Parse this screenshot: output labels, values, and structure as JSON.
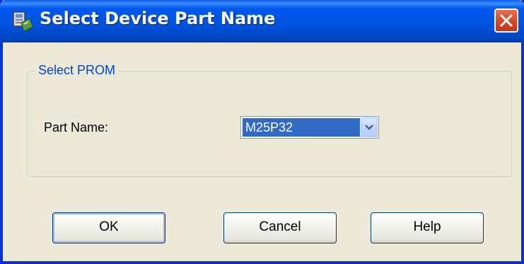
{
  "window": {
    "title": "Select Device Part Name",
    "colors": {
      "titlebar": "#0058EE",
      "frame": "#0831D9",
      "dialog_bg": "#ECE9D8",
      "group_label": "#0046D5",
      "selection": "#316AC5",
      "close_button": "#D84A2A"
    }
  },
  "group": {
    "label": "Select PROM"
  },
  "part": {
    "label": "Part Name:",
    "value": "M25P32"
  },
  "buttons": {
    "ok_label": "OK",
    "cancel_label": "Cancel",
    "help_label": "Help"
  },
  "icons": {
    "app": "device-app-icon",
    "close": "close-icon",
    "dropdown": "chevron-down-icon"
  }
}
